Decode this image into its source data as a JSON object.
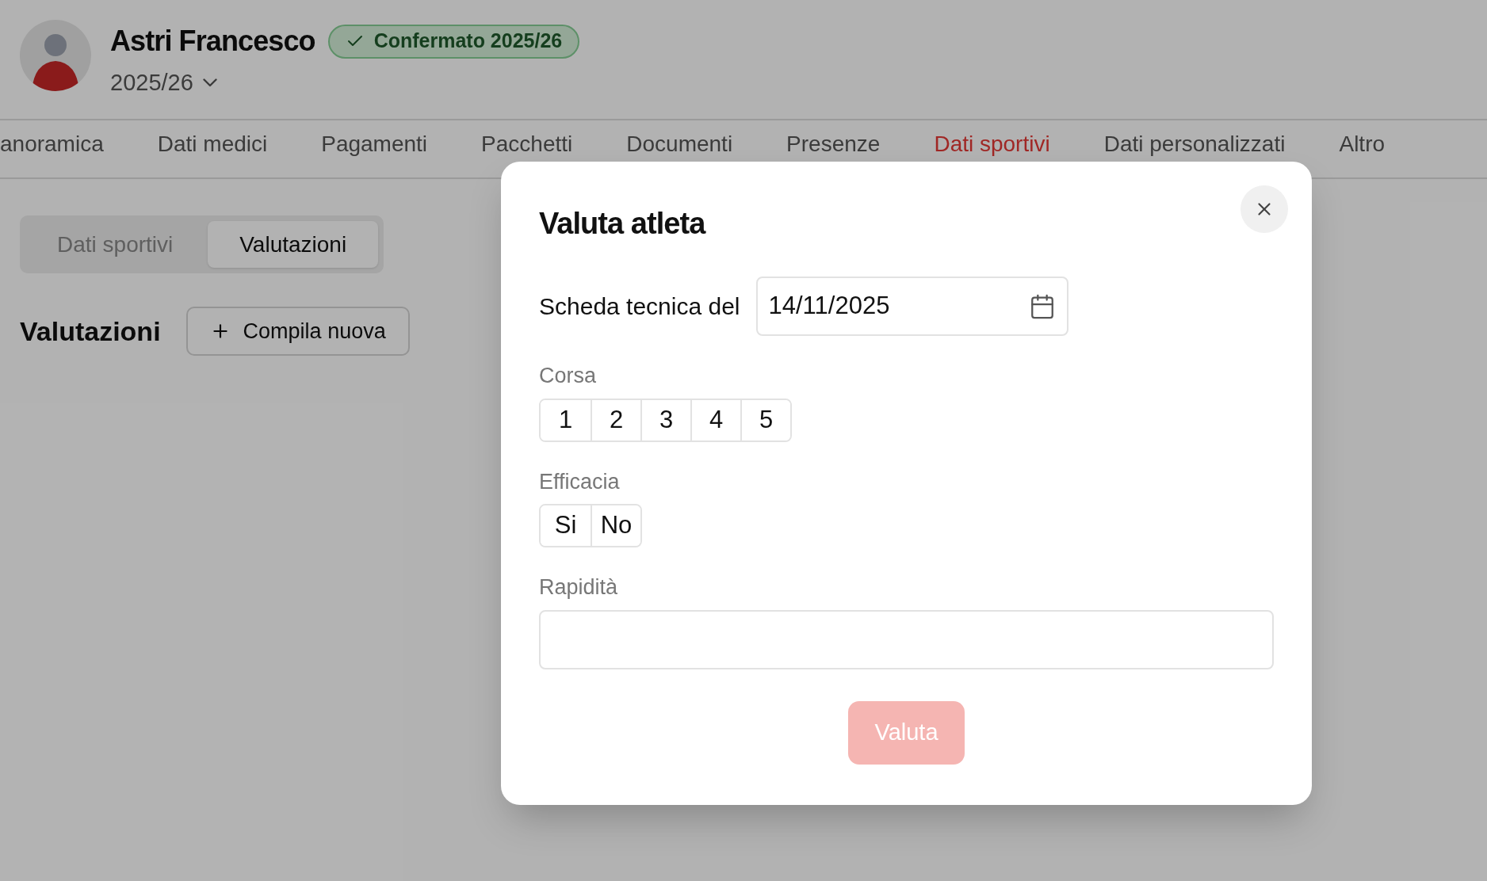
{
  "profile": {
    "name": "Astri Francesco",
    "status_badge": "Confermato 2025/26",
    "season": "2025/26"
  },
  "tabs": [
    {
      "label": "anoramica",
      "selected": false
    },
    {
      "label": "Dati medici",
      "selected": false
    },
    {
      "label": "Pagamenti",
      "selected": false
    },
    {
      "label": "Pacchetti",
      "selected": false
    },
    {
      "label": "Documenti",
      "selected": false
    },
    {
      "label": "Presenze",
      "selected": false
    },
    {
      "label": "Dati sportivi",
      "selected": true
    },
    {
      "label": "Dati personalizzati",
      "selected": false
    },
    {
      "label": "Altro",
      "selected": false
    }
  ],
  "subtabs": [
    {
      "label": "Dati sportivi",
      "selected": false
    },
    {
      "label": "Valutazioni",
      "selected": true
    }
  ],
  "section": {
    "title": "Valutazioni",
    "new_button": "Compila nuova"
  },
  "dialog": {
    "title": "Valuta atleta",
    "date_label": "Scheda tecnica del",
    "date_value": "14/11/2025",
    "fields": [
      {
        "kind": "choice",
        "label": "Corsa",
        "options": [
          {
            "label": "1",
            "selected": false
          },
          {
            "label": "2",
            "selected": false
          },
          {
            "label": "3",
            "selected": false
          },
          {
            "label": "4",
            "selected": false
          },
          {
            "label": "5",
            "selected": false
          }
        ]
      },
      {
        "kind": "choice",
        "label": "Efficacia",
        "options": [
          {
            "label": "Si",
            "selected": false
          },
          {
            "label": "No",
            "selected": false
          }
        ]
      },
      {
        "kind": "text",
        "label": "Rapidità"
      }
    ],
    "submit": {
      "label": "Valuta",
      "disabled": true
    }
  }
}
